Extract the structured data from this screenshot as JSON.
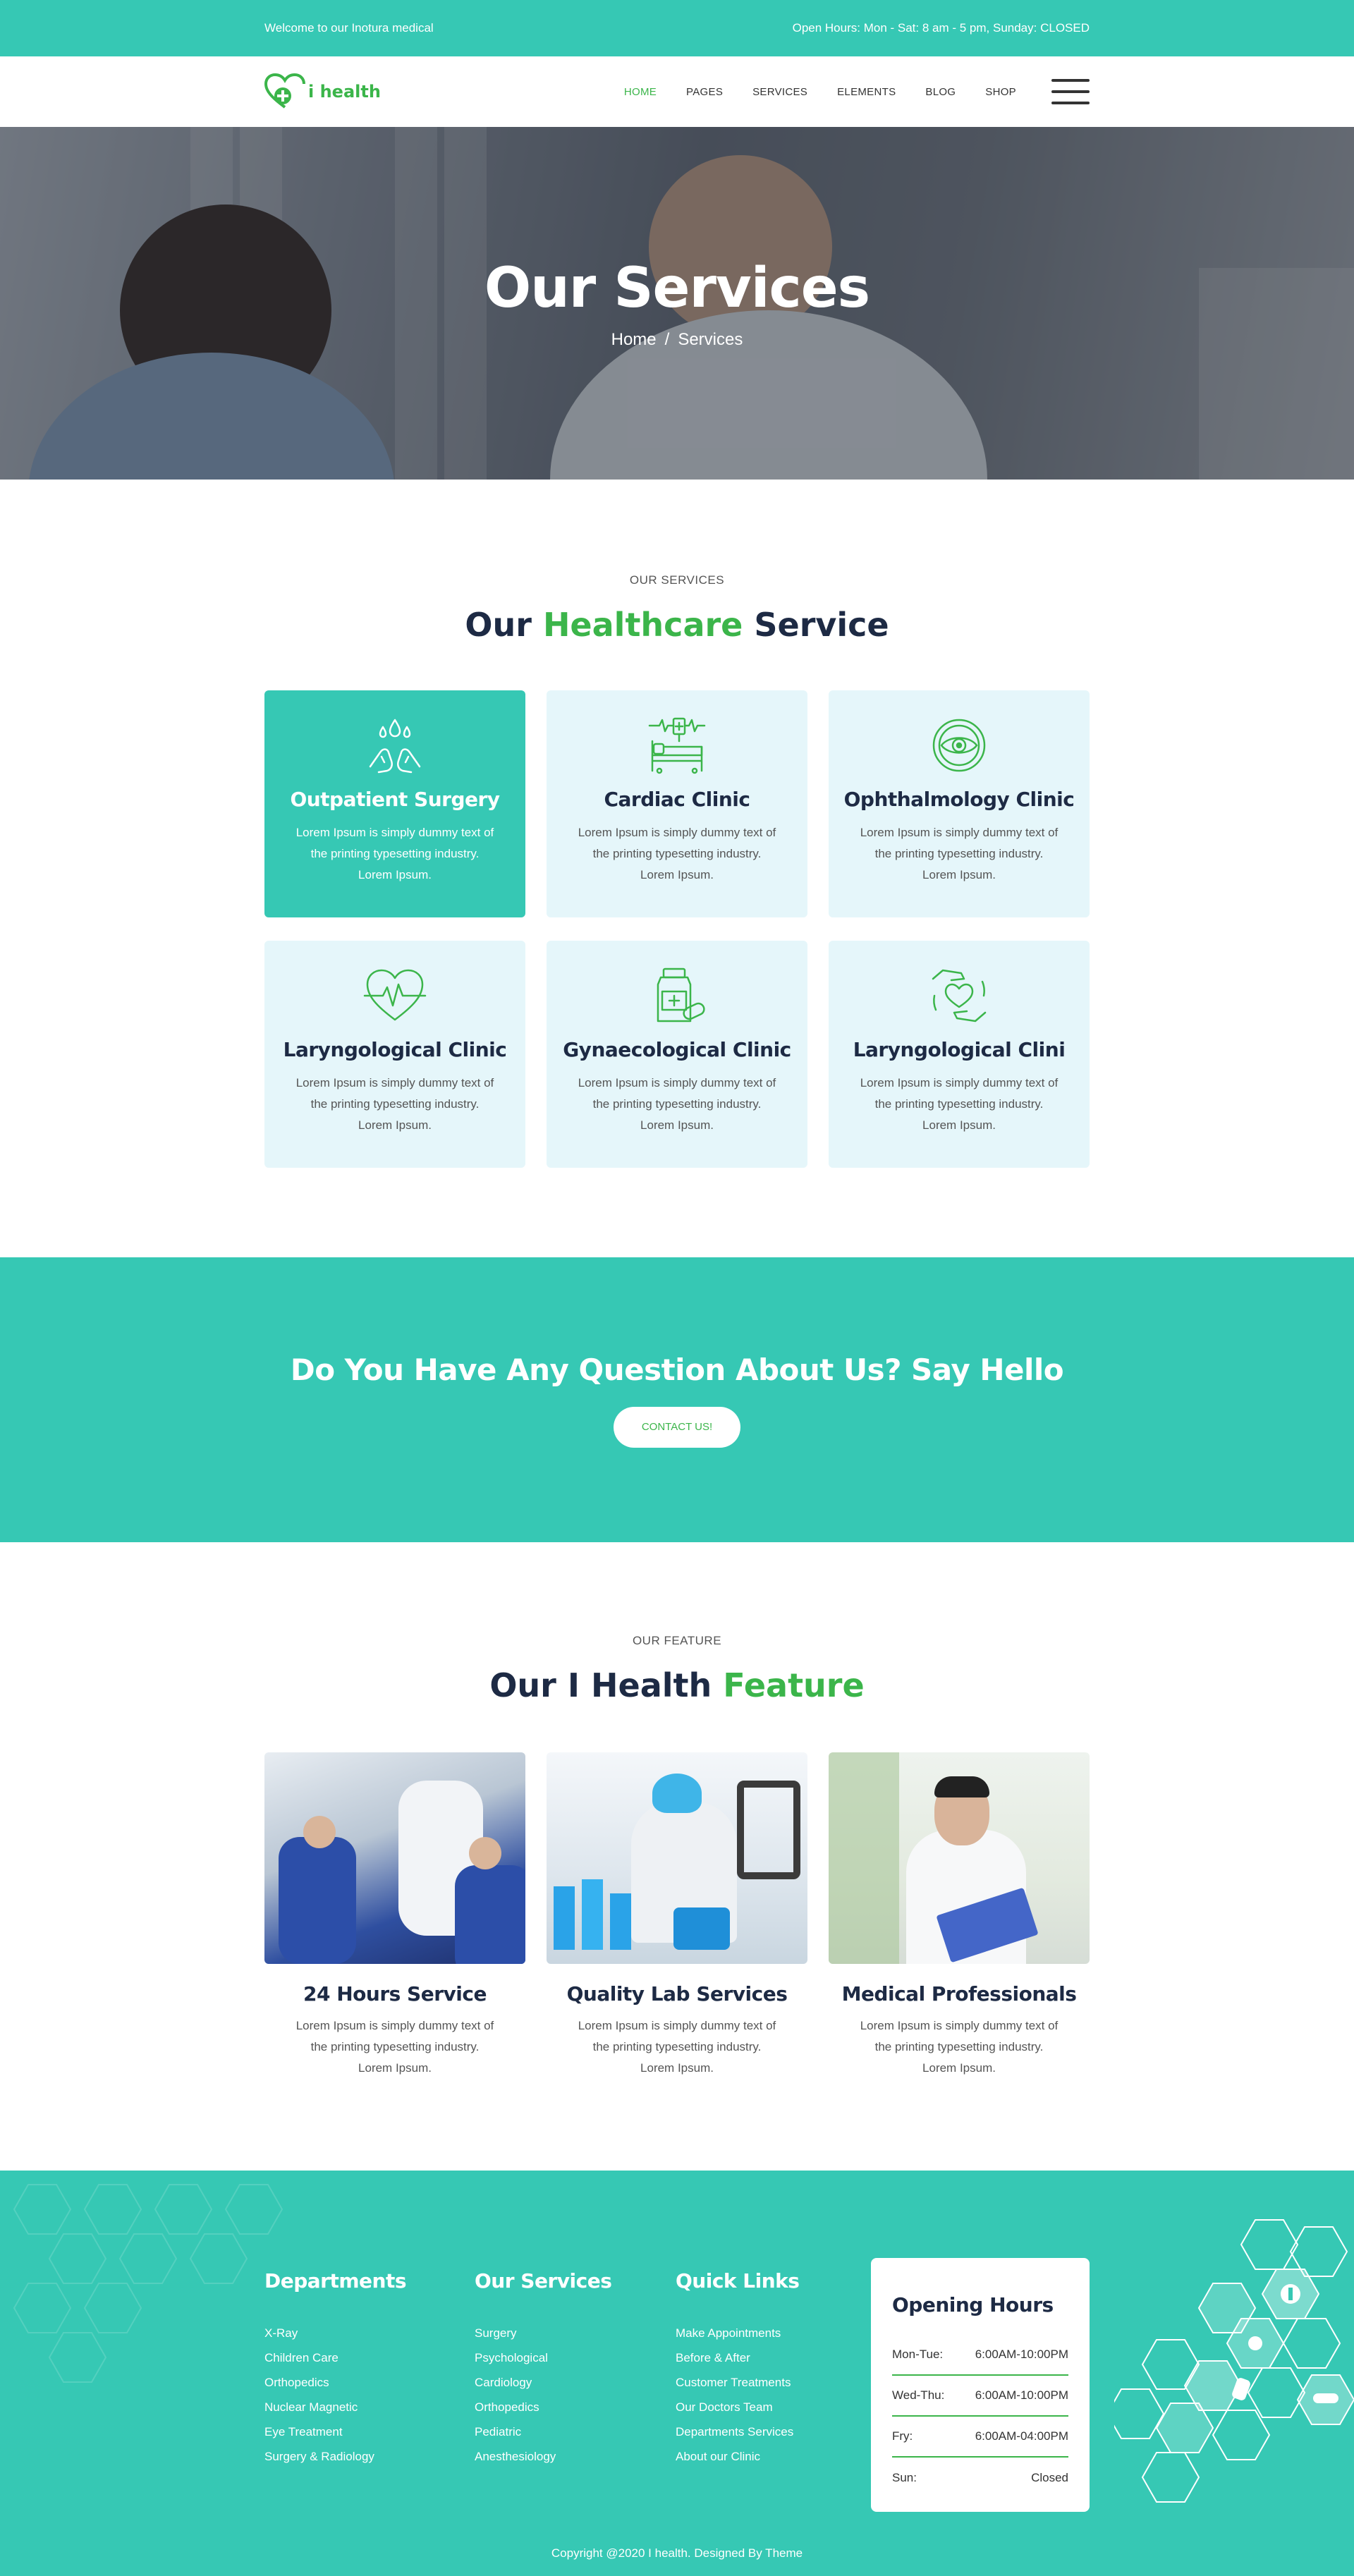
{
  "topbar": {
    "welcome": "Welcome to our Inotura medical",
    "hours": "Open Hours: Mon - Sat: 8 am - 5 pm, Sunday: CLOSED"
  },
  "logo": {
    "text": "i health",
    "icon": "heart-plus-icon"
  },
  "nav": {
    "items": [
      "HOME",
      "PAGES",
      "SERVICES",
      "ELEMENTS",
      "BLOG",
      "SHOP"
    ],
    "active": "HOME"
  },
  "hero": {
    "title": "Our Services",
    "breadcrumb_home": "Home",
    "breadcrumb_sep": "/",
    "breadcrumb_current": "Services"
  },
  "services": {
    "label": "OUR SERVICES",
    "title_a": "Our",
    "title_hl": "Healthcare",
    "title_b": "Service",
    "cards": [
      {
        "title": "Outpatient Surgery",
        "text": "Lorem Ipsum is simply dummy text of the printing typesetting industry. Lorem Ipsum.",
        "icon": "hands-drops-icon"
      },
      {
        "title": "Cardiac Clinic",
        "text": "Lorem Ipsum is simply dummy text of the printing typesetting industry. Lorem Ipsum.",
        "icon": "hospital-bed-icon"
      },
      {
        "title": "Ophthalmology Clinic",
        "text": "Lorem Ipsum is simply dummy text of the printing typesetting industry. Lorem Ipsum.",
        "icon": "eye-icon"
      },
      {
        "title": "Laryngological Clinic",
        "text": "Lorem Ipsum is simply dummy text of the printing typesetting industry. Lorem Ipsum.",
        "icon": "heartbeat-icon"
      },
      {
        "title": "Gynaecological Clinic",
        "text": "Lorem Ipsum is simply dummy text of the printing typesetting industry. Lorem Ipsum.",
        "icon": "medicine-bottle-icon"
      },
      {
        "title": "Laryngological Clini",
        "text": "Lorem Ipsum is simply dummy text of the printing typesetting industry. Lorem Ipsum.",
        "icon": "hands-heart-icon"
      }
    ]
  },
  "cta": {
    "title": "Do You Have Any Question About Us? Say Hello",
    "button": "CONTACT US!"
  },
  "feature": {
    "label": "OUR FEATURE",
    "title_a": "Our I Health",
    "title_hl": "Feature",
    "cards": [
      {
        "title": "24 Hours Service",
        "text": "Lorem Ipsum is simply dummy text of the printing typesetting industry. Lorem Ipsum."
      },
      {
        "title": "Quality Lab Services",
        "text": "Lorem Ipsum is simply dummy text of the printing typesetting industry. Lorem Ipsum."
      },
      {
        "title": "Medical Professionals",
        "text": "Lorem Ipsum is simply dummy text of the printing typesetting industry. Lorem Ipsum."
      }
    ]
  },
  "footer": {
    "departments": {
      "title": "Departments",
      "items": [
        "X-Ray",
        "Children Care",
        "Orthopedics",
        "Nuclear Magnetic",
        "Eye Treatment",
        "Surgery & Radiology"
      ]
    },
    "our_services": {
      "title": "Our Services",
      "items": [
        "Surgery",
        "Psychological",
        "Cardiology",
        "Orthopedics",
        "Pediatric",
        "Anesthesiology"
      ]
    },
    "quick_links": {
      "title": "Quick Links",
      "items": [
        "Make Appointments",
        "Before & After",
        "Customer Treatments",
        "Our Doctors Team",
        "Departments Services",
        "About our Clinic"
      ]
    },
    "opening_hours": {
      "title": "Opening Hours",
      "rows": [
        {
          "day": "Mon-Tue:",
          "time": "6:00AM-10:00PM"
        },
        {
          "day": "Wed-Thu:",
          "time": "6:00AM-10:00PM"
        },
        {
          "day": "Fry:",
          "time": "6:00AM-04:00PM"
        },
        {
          "day": "Sun:",
          "time": "Closed"
        }
      ]
    },
    "copyright": "Copyright @2020 I health. Designed By Theme"
  },
  "colors": {
    "teal": "#36c8b4",
    "green": "#3bb54a",
    "navy": "#1d2a44",
    "card_bg": "#e5f6fa"
  }
}
